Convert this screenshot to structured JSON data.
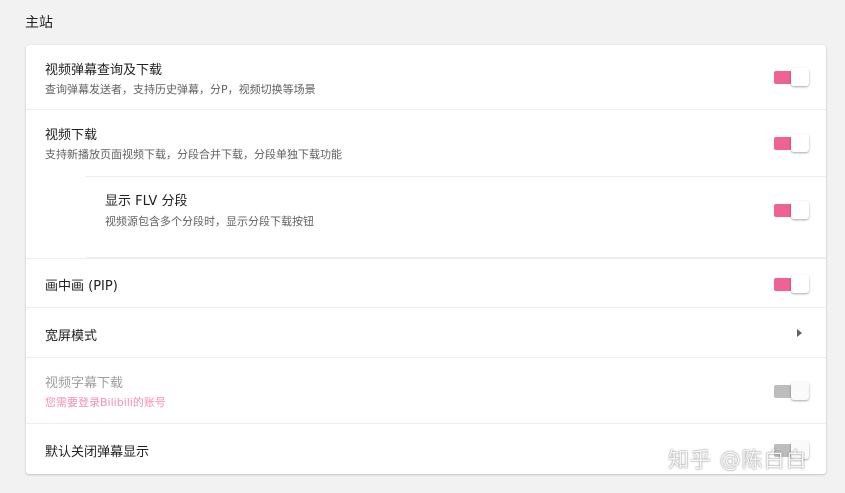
{
  "section": {
    "title": "主站"
  },
  "settings": [
    {
      "title": "视频弹幕查询及下载",
      "description": "查询弹幕发送者，支持历史弹幕，分P，视频切换等场景",
      "control": "toggle",
      "enabled": true
    },
    {
      "title": "视频下载",
      "description": "支持新播放页面视频下载，分段合并下载，分段单独下载功能",
      "control": "toggle",
      "enabled": true
    },
    {
      "title": "显示 FLV 分段",
      "description": "视频源包含多个分段时，显示分段下载按钮",
      "control": "toggle",
      "enabled": true
    },
    {
      "title": "画中画 (PIP)",
      "control": "toggle",
      "enabled": true
    },
    {
      "title": "宽屏模式",
      "control": "submenu"
    },
    {
      "title": "视频字幕下载",
      "description": "您需要登录Bilibili的账号",
      "control": "toggle",
      "enabled": false,
      "disabled": true
    },
    {
      "title": "默认关闭弹幕显示",
      "control": "toggle",
      "enabled": false
    }
  ],
  "watermark": {
    "text": "知乎 @陈白白"
  },
  "colors": {
    "toggle_on": "#f06292",
    "toggle_off": "#bdbdbd",
    "disabled_hint": "#f48fb1",
    "background": "#f2f2f2"
  }
}
